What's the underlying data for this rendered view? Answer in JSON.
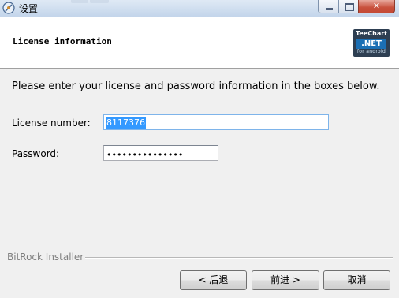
{
  "window": {
    "title": "设置",
    "controls": {
      "minimize": "",
      "maximize": "",
      "close": "✕"
    }
  },
  "header": {
    "title": "License information",
    "logo": {
      "line1": "TeeChart",
      "line2": ".NET",
      "line3": "for android"
    }
  },
  "form": {
    "prompt": "Please enter your license and password information in the boxes below.",
    "license_label": "License number:",
    "license_value": "8117376",
    "password_label": "Password:",
    "password_mask": "•••••••••••••••"
  },
  "footer": {
    "installer_label": "BitRock Installer",
    "back_button": "< 后退",
    "next_button": "前进 >",
    "cancel_button": "取消"
  }
}
